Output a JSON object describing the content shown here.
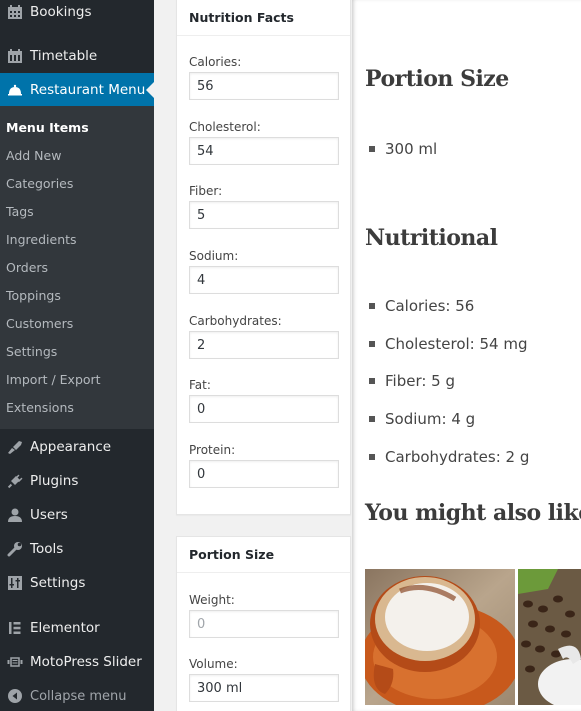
{
  "sidebar": {
    "top_items": [
      {
        "label": "Bookings",
        "icon": "calendar-icon"
      },
      {
        "label": "Timetable",
        "icon": "calendar-icon"
      },
      {
        "label": "Restaurant Menu",
        "icon": "food-cloche-icon",
        "active": true
      }
    ],
    "submenu": [
      {
        "label": "Menu Items",
        "current": true
      },
      {
        "label": "Add New"
      },
      {
        "label": "Categories"
      },
      {
        "label": "Tags"
      },
      {
        "label": "Ingredients"
      },
      {
        "label": "Orders"
      },
      {
        "label": "Toppings"
      },
      {
        "label": "Customers"
      },
      {
        "label": "Settings"
      },
      {
        "label": "Import / Export"
      },
      {
        "label": "Extensions"
      }
    ],
    "bottom_items": [
      {
        "label": "Appearance",
        "icon": "paintbrush-icon"
      },
      {
        "label": "Plugins",
        "icon": "plug-icon"
      },
      {
        "label": "Users",
        "icon": "user-icon"
      },
      {
        "label": "Tools",
        "icon": "wrench-icon"
      },
      {
        "label": "Settings",
        "icon": "sliders-icon"
      },
      {
        "label": "Elementor",
        "icon": "elementor-icon"
      },
      {
        "label": "MotoPress Slider",
        "icon": "slider-icon"
      },
      {
        "label": "Collapse menu",
        "icon": "collapse-icon"
      }
    ]
  },
  "nutrition_box": {
    "title": "Nutrition Facts",
    "fields": [
      {
        "label": "Calories:",
        "value": "56"
      },
      {
        "label": "Cholesterol:",
        "value": "54"
      },
      {
        "label": "Fiber:",
        "value": "5"
      },
      {
        "label": "Sodium:",
        "value": "4"
      },
      {
        "label": "Carbohydrates:",
        "value": "2"
      },
      {
        "label": "Fat:",
        "value": "0"
      },
      {
        "label": "Protein:",
        "value": "0"
      }
    ]
  },
  "portion_box": {
    "title": "Portion Size",
    "fields": [
      {
        "label": "Weight:",
        "value": "",
        "placeholder": "0"
      },
      {
        "label": "Volume:",
        "value": "300 ml"
      }
    ]
  },
  "preview": {
    "portion_heading": "Portion Size",
    "portion_items": [
      "300 ml"
    ],
    "nutritional_heading": "Nutritional",
    "nutritional_items": [
      "Calories: 56",
      "Cholesterol: 54 mg",
      "Fiber: 5 g",
      "Sodium: 4 g",
      "Carbohydrates: 2 g"
    ],
    "related_heading": "You might also like",
    "related_images": [
      "cappuccino-cup-photo",
      "coffee-beans-photo"
    ]
  },
  "colors": {
    "sidebar_bg": "#23282d",
    "submenu_bg": "#32373c",
    "active_bg": "#0073aa"
  }
}
